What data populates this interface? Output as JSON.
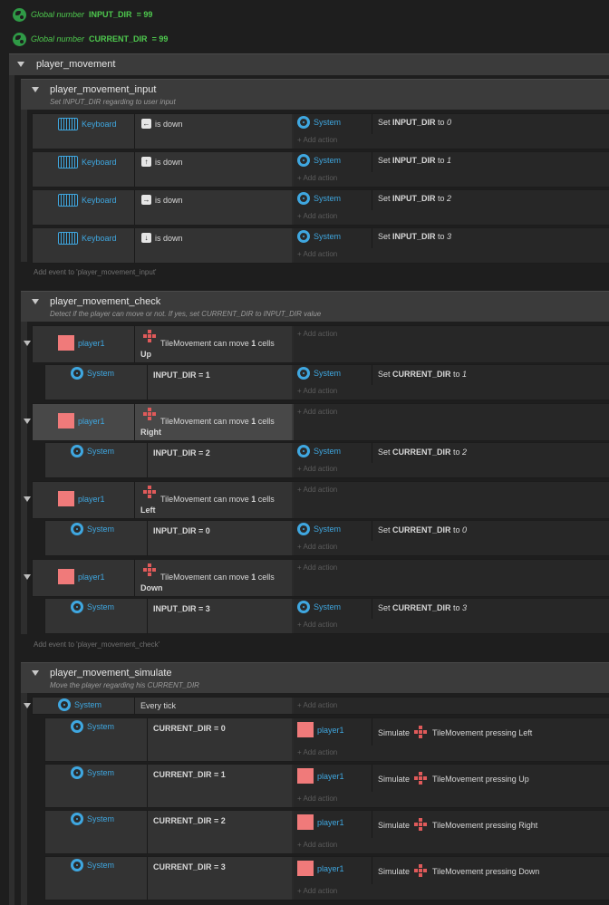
{
  "globals": [
    {
      "prefix": "Global number",
      "name": "INPUT_DIR",
      "eq": "= 99"
    },
    {
      "prefix": "Global number",
      "name": "CURRENT_DIR",
      "eq": "= 99"
    }
  ],
  "outer_group": "player_movement",
  "groups": {
    "input": {
      "name": "player_movement_input",
      "desc": "Set INPUT_DIR regarding to user input",
      "add_event": "Add event to 'player_movement_input'"
    },
    "check": {
      "name": "player_movement_check",
      "desc": "Detect if the player can move or not. If yes, set CURRENT_DIR to INPUT_DIR value",
      "add_event": "Add event to 'player_movement_check'"
    },
    "simulate": {
      "name": "player_movement_simulate",
      "desc": "Move the player regarding his CURRENT_DIR"
    }
  },
  "labels": {
    "keyboard": "Keyboard",
    "system": "System",
    "player": "player1",
    "add_action": "+ Add action",
    "is_down": "is down",
    "set": "Set",
    "to": "to",
    "tm_can_move": "TileMovement can move",
    "cells": "cells",
    "every_tick": "Every tick",
    "simulate": "Simulate",
    "tm_pressing": "TileMovement pressing"
  },
  "input_events": [
    {
      "key": "←",
      "var": "INPUT_DIR",
      "val": "0"
    },
    {
      "key": "↑",
      "var": "INPUT_DIR",
      "val": "1"
    },
    {
      "key": "→",
      "var": "INPUT_DIR",
      "val": "2"
    },
    {
      "key": "↓",
      "var": "INPUT_DIR",
      "val": "3"
    }
  ],
  "check_events": [
    {
      "dir": "Up",
      "cells": "1",
      "cond": "INPUT_DIR = 1",
      "var": "CURRENT_DIR",
      "val": "1"
    },
    {
      "dir": "Right",
      "cells": "1",
      "cond": "INPUT_DIR = 2",
      "var": "CURRENT_DIR",
      "val": "2"
    },
    {
      "dir": "Left",
      "cells": "1",
      "cond": "INPUT_DIR = 0",
      "var": "CURRENT_DIR",
      "val": "0"
    },
    {
      "dir": "Down",
      "cells": "1",
      "cond": "INPUT_DIR = 3",
      "var": "CURRENT_DIR",
      "val": "3"
    }
  ],
  "simulate_events": [
    {
      "cond": "CURRENT_DIR = 0",
      "dir": "Left"
    },
    {
      "cond": "CURRENT_DIR = 1",
      "dir": "Up"
    },
    {
      "cond": "CURRENT_DIR = 2",
      "dir": "Right"
    },
    {
      "cond": "CURRENT_DIR = 3",
      "dir": "Down"
    }
  ]
}
